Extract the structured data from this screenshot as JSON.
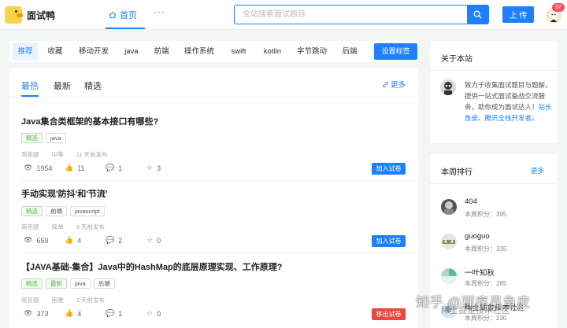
{
  "header": {
    "site_name": "面试鸭",
    "nav_home": "首页",
    "nav_more": "···",
    "search_placeholder": "全站搜索面试题目",
    "upload_label": "上 传",
    "notification_count": "37"
  },
  "tag_bar": {
    "tags": [
      "推荐",
      "收藏",
      "移动开发",
      "java",
      "前端",
      "操作系统",
      "swift",
      "kotlin",
      "字节跳动",
      "后端"
    ],
    "active_index": 0,
    "set_tags_label": "设置标签"
  },
  "feed": {
    "tabs": [
      "最热",
      "最新",
      "精选"
    ],
    "active_tab": 0,
    "more_label": "更多",
    "items": [
      {
        "title": "Java集合类框架的基本接口有哪些?",
        "chips": [
          "精选",
          "java"
        ],
        "chip_styles": [
          "green",
          "plain"
        ],
        "meta": [
          "简答题",
          "中等",
          "11 天前发布"
        ],
        "stats": {
          "views": "1954",
          "likes": "11",
          "comments": "1",
          "stars": "3"
        },
        "action": "加入试卷"
      },
      {
        "title": "手动实现'防抖'和'节流'",
        "chips": [
          "精选",
          "前端",
          "javascript"
        ],
        "chip_styles": [
          "green",
          "plain",
          "plain"
        ],
        "meta": [
          "简答题",
          "简单",
          "8 天前发布"
        ],
        "stats": {
          "views": "659",
          "likes": "4",
          "comments": "2",
          "stars": "0"
        },
        "action": "加入试卷"
      },
      {
        "title": "【JAVA基础-集合】Java中的HashMap的底层原理实现、工作原理?",
        "chips": [
          "精选",
          "最新",
          "java",
          "后端"
        ],
        "chip_styles": [
          "green",
          "green",
          "plain",
          "plain"
        ],
        "meta": [
          "简答题",
          "困难",
          "2 天前发布"
        ],
        "stats": {
          "views": "373",
          "likes": "4",
          "comments": "1",
          "stars": "0"
        },
        "action": "移出试卷"
      }
    ]
  },
  "about": {
    "title": "关于本站",
    "text": "致力于收集面试题目与题解，提供一站式面试备战交流服务，助你成为面试达人！",
    "link_1": "站长鱼皮",
    "separator": "、",
    "link_2": "腾讯全栈开发者",
    "end": "。"
  },
  "ranking": {
    "title": "本周排行",
    "more_label": "更多",
    "score_label": "本周积分：",
    "rows": [
      {
        "name": "404",
        "score": "395"
      },
      {
        "name": "guoguo",
        "score": "335"
      },
      {
        "name": "一叶知秋",
        "score": "285"
      },
      {
        "name": "稀土掘金技术社区",
        "score": "230"
      }
    ]
  },
  "watermark": {
    "text": "知乎 @程序员鱼皮",
    "sub": "稀土掘金技术社区"
  },
  "colors": {
    "accent": "#1e80ff",
    "danger": "#e8483e",
    "success": "#52b544"
  }
}
